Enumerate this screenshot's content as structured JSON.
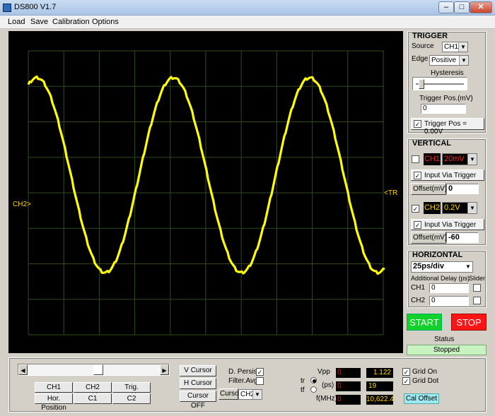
{
  "window": {
    "title": "DS800 V1.7",
    "min": "–",
    "max": "□",
    "close": "✕"
  },
  "menu": [
    "Load",
    "Save",
    "Calibration",
    "Options"
  ],
  "scope": {
    "ch2_marker": "CH2>",
    "trig_marker": "<TR",
    "grid_color": "#2a3a22",
    "trace_color": "#ffff00",
    "bg_color": "#000000"
  },
  "trigger": {
    "header": "TRIGGER",
    "source_label": "Source",
    "source_value": "CH1",
    "edge_label": "Edge",
    "edge_value": "Positive",
    "hysteresis_label": "Hysteresis",
    "pos_label": "Trigger Pos.(mV)",
    "pos_value": "0",
    "pos_check_label": "Trigger Pos = 0.00V"
  },
  "vertical": {
    "header": "VERTICAL",
    "ch1_label": "CH1",
    "ch1_scale": "20mV",
    "ch1_input_trigger": "Input Via Trigger",
    "ch1_offset_label": "Offset(mV)",
    "ch1_offset_value": "0",
    "ch2_label": "CH2",
    "ch2_scale": "0.2V",
    "ch2_input_trigger": "Input Via Trigger",
    "ch2_offset_label": "Offset(mV)",
    "ch2_offset_value": "-60"
  },
  "horizontal": {
    "header": "HORIZONTAL",
    "timebase": "25ps/div",
    "delay_label": "Additional Delay (ps)",
    "slider_label": "Slider",
    "ch1_label": "CH1",
    "ch1_value": "0",
    "ch2_label": "CH2",
    "ch2_value": "0"
  },
  "control": {
    "start": "START",
    "stop": "STOP",
    "status_label": "Status",
    "status_value": "Stopped"
  },
  "bottom": {
    "ch1_position": "CH1 Position",
    "ch2_position": "CH2 Position",
    "trig_position": "Trig. Position",
    "hor_position": "Hor. Position",
    "c1": "C1",
    "c2": "C2",
    "v_cursor": "V Cursor",
    "h_cursor": "H Cursor",
    "cursor_off": "Cursor OFF",
    "d_persist": "D. Persist",
    "filter_avg": "Filter.Avg",
    "cursor_label": "Cursor",
    "cursor_value": "CH2",
    "tr": "tr",
    "tf": "tf",
    "vpp_label": "Vpp",
    "ps_label": "(ps)",
    "fmhz_label": "f(MHz)",
    "vpp_ch1": "0",
    "vpp_ch2": "1.122",
    "ps_ch1": "0",
    "ps_ch2": "19",
    "f_ch1": "0",
    "f_ch2": "10,622.4",
    "grid_on": "Grid On",
    "grid_dot": "Grid Dot",
    "cal_offset": "Cal Offset"
  }
}
